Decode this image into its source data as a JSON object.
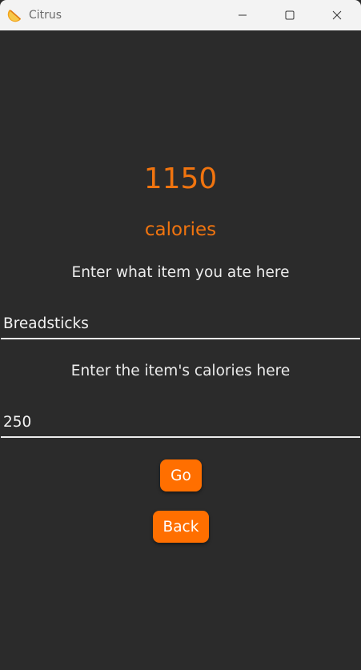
{
  "window": {
    "title": "Citrus",
    "icon": "citrus-slice-icon",
    "controls": [
      "minimize-icon",
      "maximize-icon",
      "close-icon"
    ]
  },
  "main": {
    "calories_total": "1150",
    "calories_unit": "calories",
    "item_prompt": "Enter what item you ate here",
    "item_value": "Breadsticks",
    "calories_prompt": "Enter the item's calories here",
    "calories_value": "250",
    "go_label": "Go",
    "back_label": "Back"
  },
  "colors": {
    "accent": "#ff6f00",
    "accent_text": "#f0740f",
    "background": "#2b2b2b",
    "titlebar": "#f3f3f3"
  }
}
